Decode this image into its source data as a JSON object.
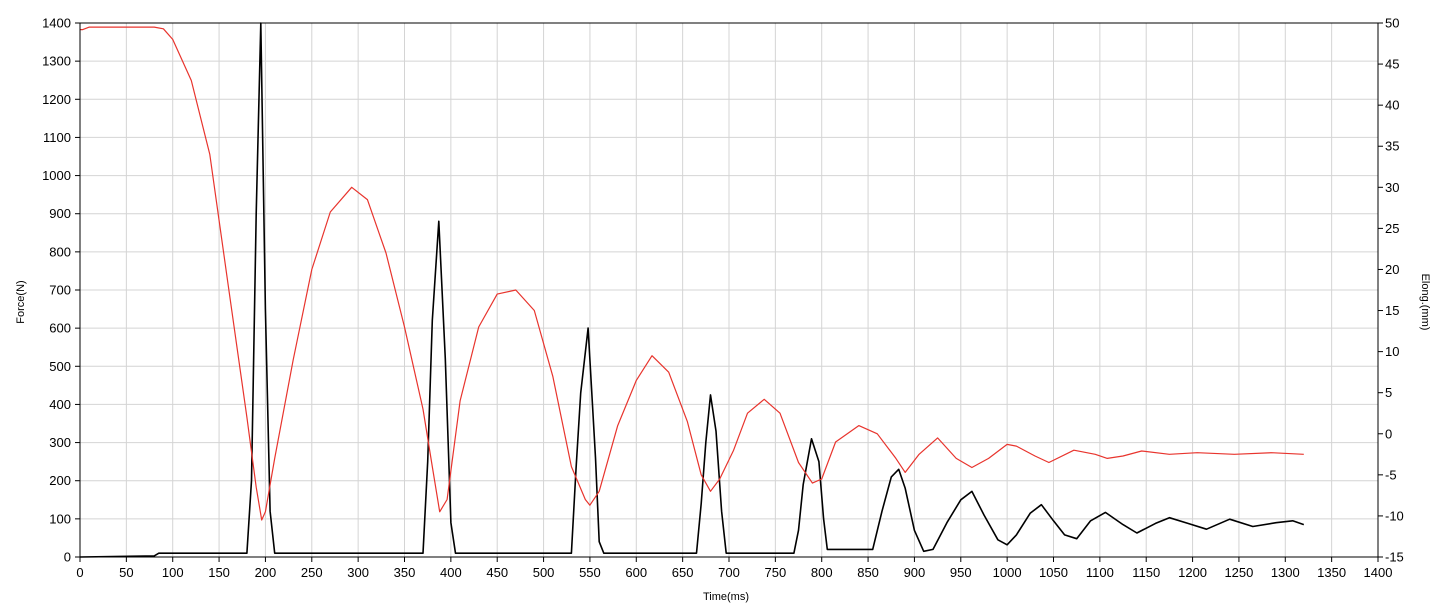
{
  "chart_data": {
    "type": "line",
    "title": "",
    "xlabel": "Time(ms)",
    "ylabel": "Force(N)",
    "y2label": "Elong.(mm)",
    "xlim": [
      0,
      1400
    ],
    "ylim": [
      0,
      1400
    ],
    "y2lim": [
      -15,
      50
    ],
    "xticks": [
      0,
      50,
      100,
      150,
      200,
      250,
      300,
      350,
      400,
      450,
      500,
      550,
      600,
      650,
      700,
      750,
      800,
      850,
      900,
      950,
      1000,
      1050,
      1100,
      1150,
      1200,
      1250,
      1300,
      1350,
      1400
    ],
    "yticks": [
      0,
      100,
      200,
      300,
      400,
      500,
      600,
      700,
      800,
      900,
      1000,
      1100,
      1200,
      1300,
      1400
    ],
    "y2ticks": [
      -15,
      -10,
      -5,
      0,
      5,
      10,
      15,
      20,
      25,
      30,
      35,
      40,
      45,
      50
    ],
    "grid": true,
    "legend": "none",
    "series": [
      {
        "axis": "left",
        "color": "#000000",
        "x": [
          0,
          80,
          85,
          180,
          185,
          190,
          195,
          200,
          205,
          210,
          215,
          370,
          375,
          380,
          387,
          394,
          400,
          405,
          530,
          535,
          540,
          548,
          556,
          560,
          565,
          665,
          670,
          675,
          680,
          686,
          692,
          697,
          770,
          775,
          780,
          789,
          797,
          802,
          806,
          855,
          865,
          875,
          883,
          890,
          900,
          910,
          920,
          935,
          950,
          962,
          975,
          990,
          1000,
          1010,
          1025,
          1037,
          1050,
          1062,
          1075,
          1090,
          1106,
          1125,
          1140,
          1160,
          1175,
          1195,
          1215,
          1240,
          1265,
          1290,
          1308,
          1320
        ],
        "values": [
          0,
          3,
          10,
          10,
          200,
          900,
          1400,
          650,
          120,
          10,
          10,
          10,
          250,
          620,
          880,
          520,
          90,
          10,
          10,
          230,
          430,
          600,
          260,
          40,
          10,
          10,
          140,
          300,
          425,
          330,
          120,
          10,
          10,
          70,
          190,
          310,
          250,
          100,
          20,
          20,
          120,
          210,
          230,
          180,
          70,
          15,
          20,
          90,
          150,
          172,
          110,
          45,
          32,
          58,
          115,
          137,
          95,
          58,
          48,
          95,
          117,
          85,
          63,
          88,
          103,
          88,
          73,
          99,
          80,
          90,
          95,
          85
        ]
      },
      {
        "axis": "right",
        "color": "#e8342d",
        "x": [
          0,
          3,
          10,
          20,
          40,
          60,
          80,
          90,
          100,
          120,
          140,
          160,
          180,
          190,
          196,
          200,
          210,
          230,
          250,
          270,
          293,
          310,
          330,
          350,
          370,
          380,
          388,
          396,
          410,
          430,
          450,
          470,
          490,
          510,
          530,
          545,
          550,
          560,
          580,
          600,
          617,
          635,
          655,
          670,
          680,
          690,
          705,
          720,
          738,
          755,
          775,
          790,
          800,
          815,
          840,
          860,
          880,
          890,
          905,
          925,
          945,
          962,
          980,
          1000,
          1010,
          1030,
          1045,
          1072,
          1095,
          1108,
          1125,
          1145,
          1175,
          1205,
          1245,
          1285,
          1320
        ],
        "values": [
          49.2,
          49.2,
          49.5,
          49.5,
          49.5,
          49.5,
          49.5,
          49.3,
          48,
          43,
          34,
          18,
          2,
          -6.5,
          -10.5,
          -9.5,
          -3,
          9,
          20,
          27,
          30,
          28.5,
          22,
          13,
          3,
          -4,
          -9.5,
          -8,
          4,
          13,
          17,
          17.5,
          15,
          7,
          -4,
          -8,
          -8.7,
          -7,
          1,
          6.5,
          9.5,
          7.5,
          1.5,
          -5,
          -7,
          -5.5,
          -2,
          2.5,
          4.2,
          2.5,
          -3.5,
          -6,
          -5.5,
          -1,
          1,
          0,
          -3,
          -4.7,
          -2.5,
          -0.5,
          -3,
          -4.1,
          -3,
          -1.3,
          -1.5,
          -2.7,
          -3.5,
          -2,
          -2.5,
          -3,
          -2.7,
          -2.1,
          -2.5,
          -2.3,
          -2.5,
          -2.3,
          -2.5
        ]
      }
    ]
  }
}
